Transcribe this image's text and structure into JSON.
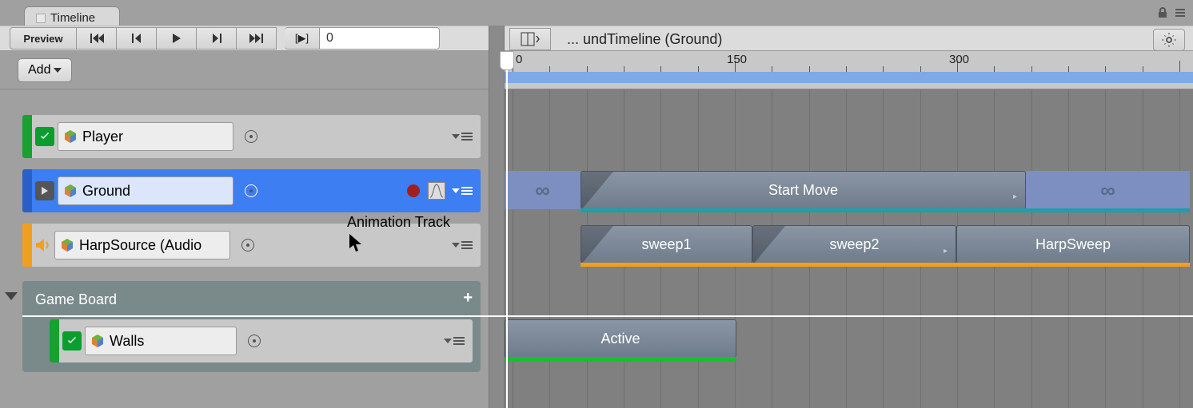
{
  "tab": {
    "label": "Timeline"
  },
  "toolbar": {
    "preview": "Preview",
    "bracket_play": "[▶]",
    "frame": "0",
    "breadcrumb": "... undTimeline (Ground)"
  },
  "add_button": "Add",
  "ruler": {
    "marks": [
      0,
      150,
      300
    ]
  },
  "tracks": [
    {
      "id": "player",
      "name": "Player",
      "type": "animation",
      "color": "#18a030",
      "selected": false
    },
    {
      "id": "ground",
      "name": "Ground",
      "type": "animation",
      "color": "#3d7ef2",
      "selected": true
    },
    {
      "id": "harp",
      "name": "HarpSource (Audio",
      "type": "audio",
      "color": "#f0a020",
      "selected": false
    }
  ],
  "group": {
    "name": "Game Board",
    "tooltip": "Animation Track",
    "children": [
      {
        "id": "walls",
        "name": "Walls",
        "type": "activation",
        "color": "#18a030"
      }
    ]
  },
  "clips": {
    "ground": {
      "pre_infinite": {
        "start": 0,
        "end": 95
      },
      "main": {
        "label": "Start Move",
        "start": 95,
        "end": 650
      },
      "post_infinite": {
        "start": 650,
        "end": 855
      }
    },
    "harp": [
      {
        "label": "sweep1",
        "start": 95,
        "end": 310
      },
      {
        "label": "sweep2",
        "start": 310,
        "end": 565
      },
      {
        "label": "HarpSweep",
        "start": 565,
        "end": 855
      }
    ],
    "walls": {
      "label": "Active",
      "start": 0,
      "end": 290
    }
  }
}
